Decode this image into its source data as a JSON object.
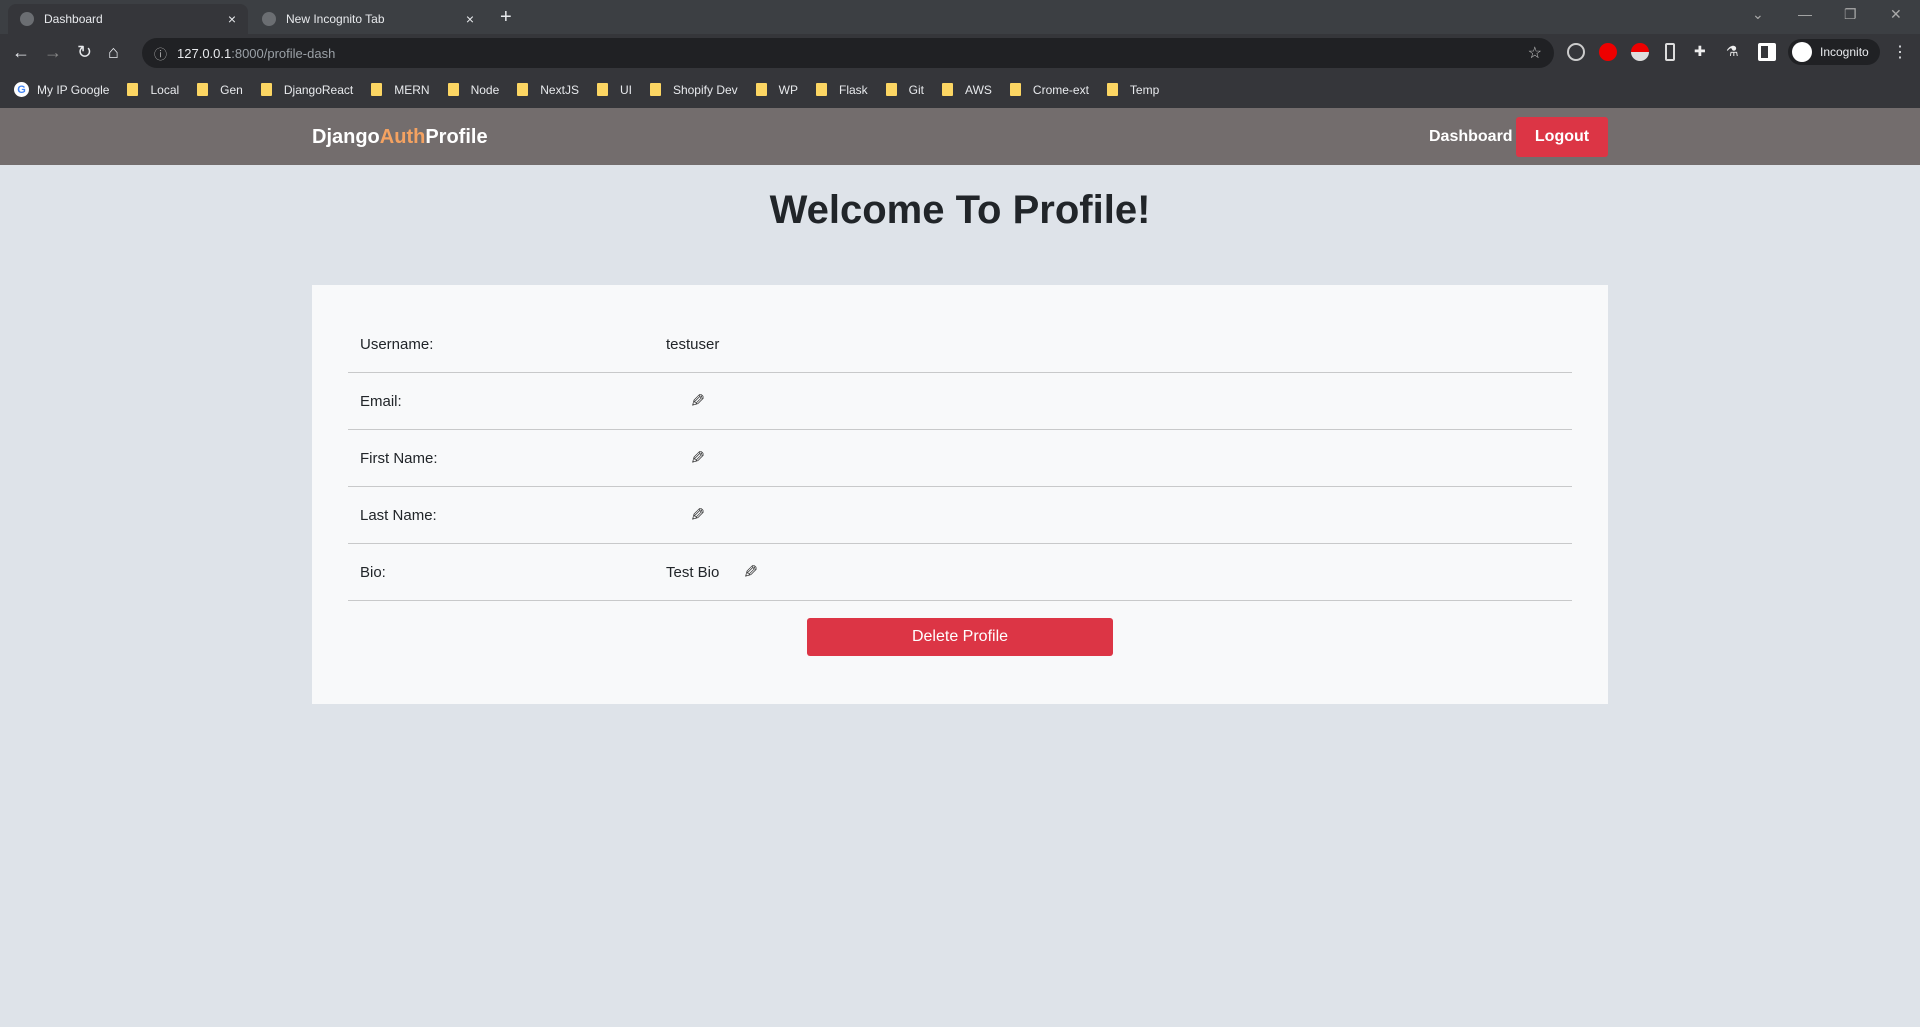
{
  "browser": {
    "tabs": [
      {
        "label": "Dashboard",
        "close": "×"
      },
      {
        "label": "New Incognito Tab",
        "close": "×"
      }
    ],
    "new_tab": "+",
    "url_host": "127.0.0.1",
    "url_rest": ":8000/profile-dash",
    "profile": "Incognito",
    "bookmarks": [
      "My IP Google",
      "Local",
      "Gen",
      "DjangoReact",
      "MERN",
      "Node",
      "NextJS",
      "UI",
      "Shopify Dev",
      "WP",
      "Flask",
      "Git",
      "AWS",
      "Crome-ext",
      "Temp"
    ]
  },
  "navbar": {
    "brand_1": "Django",
    "brand_2": "Auth",
    "brand_3": "Profile",
    "dashboard": "Dashboard",
    "logout": "Logout"
  },
  "page": {
    "title": "Welcome To Profile!"
  },
  "profile": {
    "rows": [
      {
        "label": "Username:",
        "value": "testuser"
      },
      {
        "label": "Email:",
        "value": ""
      },
      {
        "label": "First Name:",
        "value": ""
      },
      {
        "label": "Last Name:",
        "value": ""
      },
      {
        "label": "Bio:",
        "value": "Test Bio"
      }
    ],
    "delete": "Delete Profile"
  },
  "colors": {
    "danger": "#dc3545",
    "navbar": "#736d6d",
    "accent": "#f4a261",
    "background": "#dee3e9"
  }
}
